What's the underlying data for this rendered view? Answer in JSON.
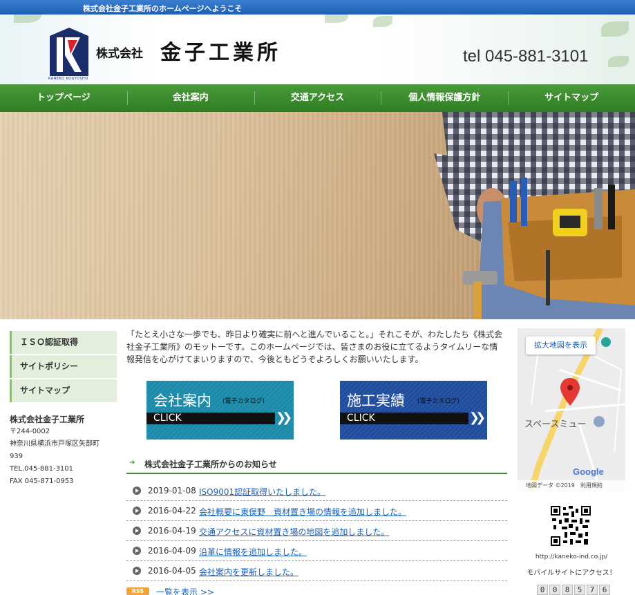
{
  "top_bar": {
    "text": "株式会社金子工業所のホームページへようこそ"
  },
  "header": {
    "logo_sub": "KANEKO KOGYOSHO",
    "company_prefix": "株式会社",
    "company_name": "金子工業所",
    "tel": "tel 045-881-3101"
  },
  "nav": {
    "items": [
      {
        "label": "トップページ"
      },
      {
        "label": "会社案内"
      },
      {
        "label": "交通アクセス"
      },
      {
        "label": "個人情報保護方針"
      },
      {
        "label": "サイトマップ"
      }
    ]
  },
  "sidebar": {
    "items": [
      {
        "label": "ＩＳＯ認証取得"
      },
      {
        "label": "サイトポリシー"
      },
      {
        "label": "サイトマップ"
      }
    ],
    "company": {
      "name": "株式会社金子工業所",
      "zip": "〒244-0002",
      "address_1": "神奈川県横浜市戸塚区矢部町",
      "address_2": "939",
      "tel": "TEL.045-881-3101",
      "fax": "FAX 045-871-0953"
    }
  },
  "intro": {
    "text": "「たとえ小さな一歩でも、昨日より確実に前へと進んでいること。」それこそが、わたしたち《株式会社金子工業所》のモットーです。このホームページでは、皆さまのお役に立てるようタイムリーな情報発信を心がけてまいりますので、今後ともどうぞよろしくお願いいたします。"
  },
  "banners": [
    {
      "title": "会社案内",
      "sub": "(電子カタログ)",
      "click": "CLICK",
      "color": "#1b8aa8"
    },
    {
      "title": "施工実績",
      "sub": "(電子カタログ)",
      "click": "CLICK",
      "color": "#1f4c9c"
    }
  ],
  "news": {
    "heading": "株式会社金子工業所からのお知らせ",
    "items": [
      {
        "date": "2019-01-08",
        "text": "ISO9001認証取得いたしました。"
      },
      {
        "date": "2016-04-22",
        "text": "会社概要に東俣野　資材置き場の情報を追加しました。"
      },
      {
        "date": "2016-04-19",
        "text": "交通アクセスに資材置き場の地図を追加しました。"
      },
      {
        "date": "2016-04-09",
        "text": "沿革に情報を追加しました。"
      },
      {
        "date": "2016-04-05",
        "text": "会社案内を更新しました。"
      }
    ],
    "rss": "RSS",
    "all_link": "一覧を表示 >>"
  },
  "map": {
    "button": "拡大地図を表示",
    "place": "スペースミュー",
    "google": "Google",
    "footer": "地図データ ©2019　利用規約"
  },
  "mobile": {
    "url": "http://kaneko-ind.co.jp/",
    "text": "モバイルサイトにアクセス！"
  },
  "counter": [
    "0",
    "0",
    "8",
    "5",
    "7",
    "6"
  ],
  "colors": {
    "green": "#3f8a2e",
    "blue_bar": "#1e5fb3",
    "link": "#1a5fb4"
  }
}
